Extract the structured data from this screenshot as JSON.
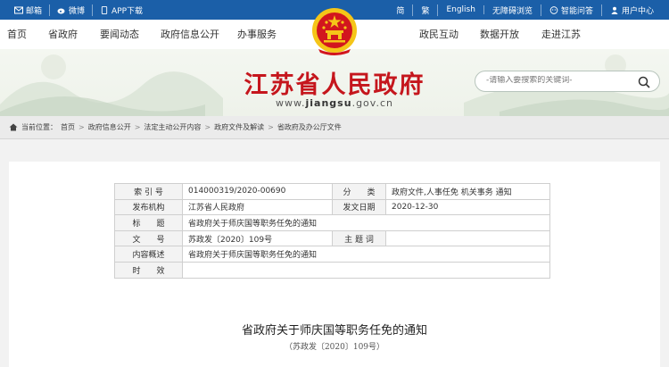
{
  "topbar": {
    "left": [
      {
        "label": "邮箱",
        "icon": "mail-icon"
      },
      {
        "label": "微博",
        "icon": "weibo-icon"
      },
      {
        "label": "APP下载",
        "icon": "app-icon"
      }
    ],
    "right": [
      {
        "label": "简"
      },
      {
        "label": "繁"
      },
      {
        "label": "English"
      },
      {
        "label": "无障碍浏览"
      },
      {
        "label": "智能问答",
        "icon": "assistant-icon"
      },
      {
        "label": "用户中心",
        "icon": "user-icon"
      }
    ]
  },
  "nav": {
    "left": [
      "首页",
      "省政府",
      "要闻动态",
      "政府信息公开",
      "办事服务"
    ],
    "right": [
      "政民互动",
      "数据开放",
      "走进江苏"
    ]
  },
  "banner": {
    "title": "江苏省人民政府",
    "url_prefix": "www.",
    "url_domain": "jiangsu",
    "url_suffix": ".gov.cn",
    "search_placeholder": "-请输入要搜索的关键词-"
  },
  "breadcrumb": {
    "label": "当前位置：",
    "items": [
      "首页",
      "政府信息公开",
      "法定主动公开内容",
      "政府文件及解读",
      "省政府及办公厅文件"
    ]
  },
  "meta": {
    "index_label": "索 引 号",
    "index_value": "014000319/2020-00690",
    "category_label": "分　　类",
    "category_value": "政府文件,人事任免 机关事务 通知",
    "issuer_label": "发布机构",
    "issuer_value": "江苏省人民政府",
    "date_label": "发文日期",
    "date_value": "2020-12-30",
    "title_label": "标　　题",
    "title_value": "省政府关于师庆国等职务任免的通知",
    "docno_label": "文　　号",
    "docno_value": "苏政发〔2020〕109号",
    "subject_label": "主 题 词",
    "subject_value": "",
    "summary_label": "内容概述",
    "summary_value": "省政府关于师庆国等职务任免的通知",
    "validity_label": "时　　效",
    "validity_value": ""
  },
  "document": {
    "title": "省政府关于师庆国等职务任免的通知",
    "number": "（苏政发〔2020〕109号）"
  },
  "colors": {
    "topbar_bg": "#1b5fa8",
    "title_red": "#c5161d",
    "emblem_red": "#d2161e",
    "emblem_gold": "#f5c518"
  }
}
